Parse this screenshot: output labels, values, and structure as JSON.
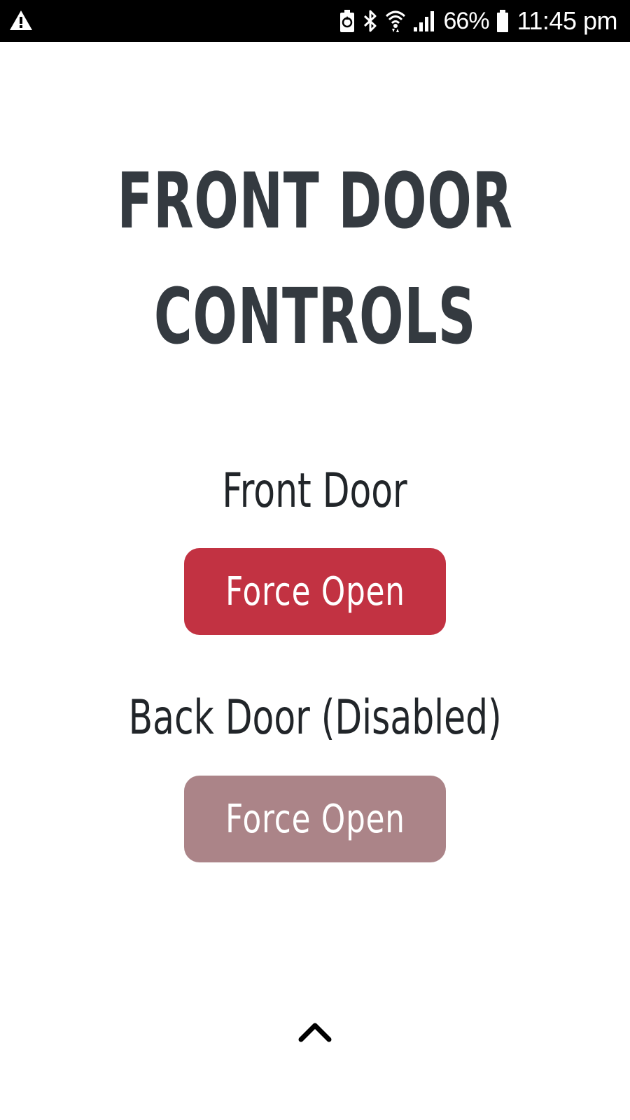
{
  "status_bar": {
    "battery_percent": "66%",
    "time": "11:45 pm",
    "icons": [
      "warning-icon",
      "battery-saver-icon",
      "bluetooth-icon",
      "wifi-icon",
      "signal-icon",
      "battery-icon"
    ]
  },
  "page": {
    "title_line1": "FRONT DOOR",
    "title_line2": "CONTROLS"
  },
  "doors": [
    {
      "label": "Front Door",
      "button_label": "Force Open",
      "disabled": false,
      "button_color": "#c23242"
    },
    {
      "label": "Back Door (Disabled)",
      "button_label": "Force Open",
      "disabled": true,
      "button_color": "#ab8488"
    }
  ],
  "colors": {
    "title": "#343a40",
    "text": "#212529",
    "background": "#ffffff"
  },
  "scroll_top_icon": "chevron-up-icon"
}
